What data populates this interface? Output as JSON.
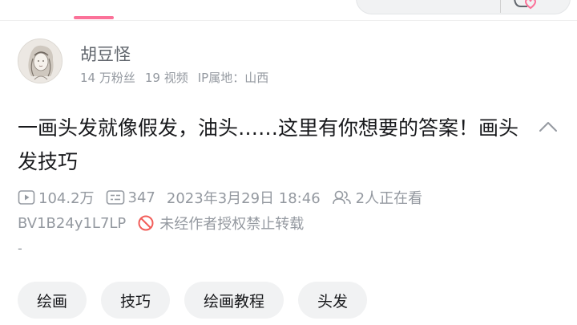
{
  "uploader": {
    "name": "胡豆怪",
    "followers": "14 万粉丝",
    "videos": "19 视频",
    "ip_location": "IP属地：山西"
  },
  "video": {
    "title": "一画头发就像假发，油头……这里有你想要的答案！画头发技巧",
    "views": "104.2万",
    "danmaku": "347",
    "publish_time": "2023年3月29日 18:46",
    "watching_now": "2人正在看",
    "bvid": "BV1B24y1L7LP",
    "copyright_notice": "未经作者授权禁止转载",
    "description": "-"
  },
  "tags": [
    "绘画",
    "技巧",
    "绘画教程",
    "头发"
  ],
  "colors": {
    "accent": "#fb7299",
    "forbid_red": "#f25d59",
    "muted_text": "#9499a0",
    "tag_bg": "#f1f2f3"
  },
  "icons": {
    "views": "play-count-icon",
    "danmaku": "danmaku-icon",
    "watching": "people-icon",
    "forbid": "forbid-icon",
    "collapse": "chevron-up-icon"
  }
}
